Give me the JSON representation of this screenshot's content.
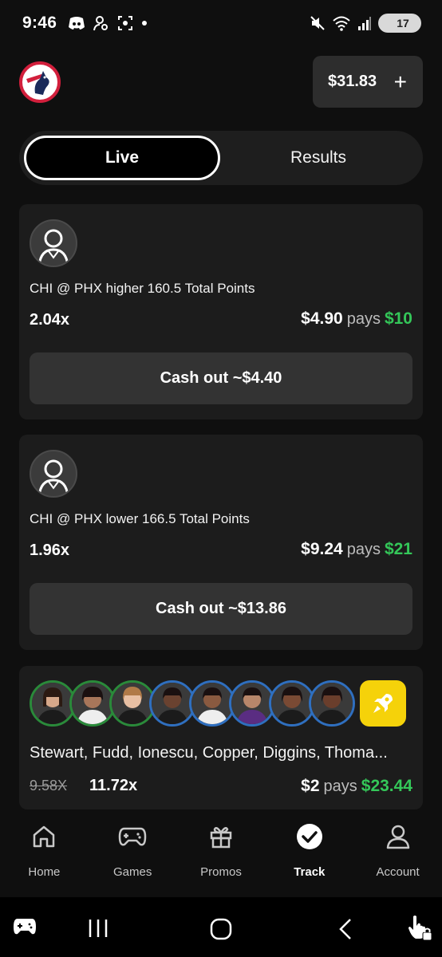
{
  "status_bar": {
    "time": "9:46",
    "battery": "17"
  },
  "header": {
    "balance": "$31.83",
    "add_symbol": "+"
  },
  "tabs": [
    {
      "label": "Live",
      "active": true
    },
    {
      "label": "Results",
      "active": false
    }
  ],
  "bets": [
    {
      "title": "CHI @ PHX higher 160.5 Total Points",
      "multiplier": "2.04x",
      "stake": "$4.90",
      "pays_label": "pays",
      "win": "$10",
      "cashout": "Cash out ~$4.40"
    },
    {
      "title": "CHI @ PHX lower 166.5 Total Points",
      "multiplier": "1.96x",
      "stake": "$9.24",
      "pays_label": "pays",
      "win": "$21",
      "cashout": "Cash out ~$13.86"
    },
    {
      "names": "Stewart, Fudd, Ionescu, Copper, Diggins, Thoma...",
      "old_multiplier": "9.58X",
      "multiplier": "11.72x",
      "stake": "$2",
      "pays_label": "pays",
      "win": "$23.44"
    }
  ],
  "nav": [
    {
      "label": "Home",
      "icon": "home-icon"
    },
    {
      "label": "Games",
      "icon": "gamepad-icon"
    },
    {
      "label": "Promos",
      "icon": "gift-icon"
    },
    {
      "label": "Track",
      "icon": "check-circle-icon",
      "active": true
    },
    {
      "label": "Account",
      "icon": "user-icon"
    }
  ],
  "colors": {
    "win_green": "#34c759",
    "boost_yellow": "#f5d20a",
    "card_bg": "#1c1c1c"
  }
}
